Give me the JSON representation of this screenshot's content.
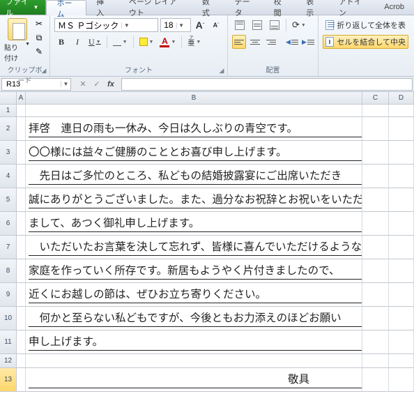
{
  "tabs": {
    "file": "ファイル",
    "home": "ホーム",
    "insert": "挿入",
    "pagelayout": "ページ レイアウト",
    "formulas": "数式",
    "data": "データ",
    "review": "校閲",
    "view": "表示",
    "addins": "アドイン",
    "acrobat": "Acrob"
  },
  "ribbon": {
    "clipboard": {
      "title": "クリップボード",
      "paste": "貼り付け"
    },
    "font": {
      "title": "フォント",
      "name": "ＭＳ Ｐゴシック",
      "size": "18",
      "bold": "B",
      "italic": "I",
      "underline": "U",
      "grow": "A",
      "shrink": "A"
    },
    "align": {
      "title": "配置"
    },
    "cells": {
      "wrap": "折り返して全体を表",
      "merge": "セルを結合して中央"
    }
  },
  "fbar": {
    "name": "R13",
    "fx": "fx"
  },
  "grid": {
    "cols": [
      "A",
      "B",
      "C",
      "D"
    ],
    "rowlabels": [
      "1",
      "2",
      "3",
      "4",
      "5",
      "6",
      "7",
      "8",
      "9",
      "10",
      "11",
      "12",
      "13"
    ],
    "heights": [
      18,
      34,
      34,
      34,
      34,
      34,
      34,
      34,
      34,
      34,
      34,
      20,
      34
    ],
    "colB": [
      "",
      "拝啓　連日の雨も一休み、今日は久しぶりの青空です。",
      "〇〇様には益々ご健勝のこととお喜び申し上げます。",
      "　先日はご多忙のところ、私どもの結婚披露宴にご出席いただき",
      "誠にありがとうございました。また、過分なお祝辞とお祝いをいただき",
      "まして、あつく御礼申し上げます。",
      "　いただいたお言葉を決して忘れず、皆様に喜んでいただけるような",
      "家庭を作っていく所存です。新居もようやく片付きましたので、",
      "近くにお越しの節は、ぜひお立ち寄りください。",
      "　何かと至らない私どもですが、今後ともお力添えのほどお願い",
      "申し上げます。",
      "",
      "　　　　　　　　　　　　　　　　　　　　　　　　敬具"
    ]
  }
}
